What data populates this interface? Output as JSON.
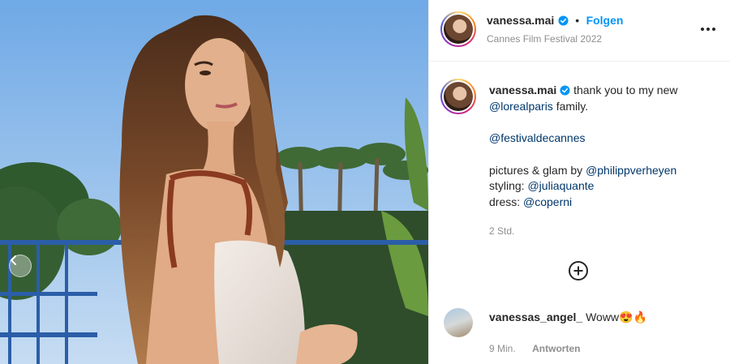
{
  "post": {
    "username": "vanessa.mai",
    "follow_label": "Folgen",
    "separator": "•",
    "location": "Cannes Film Festival 2022",
    "more_icon": "more-horizontal-icon"
  },
  "caption": {
    "username": "vanessa.mai",
    "text": "thank you to my new",
    "mention_1": "@lorealparis",
    "text_after_1": " family.",
    "mention_2": "@festivaldecannes",
    "credit_pictures": "pictures & glam by ",
    "mention_3": "@philippverheyen",
    "credit_styling": "styling: ",
    "mention_4": "@juliaquante",
    "credit_dress": "dress: ",
    "mention_5": "@coperni",
    "time": "2 Std."
  },
  "load_more_icon": "plus-circle-icon",
  "comments": [
    {
      "username": "vanessas_angel_",
      "text": "Woww😍🔥",
      "time": "9 Min.",
      "reply_label": "Antworten"
    }
  ],
  "colors": {
    "accent": "#0095f6",
    "mention": "#00376b",
    "muted": "#8e8e8e",
    "text": "#262626",
    "sky": "#7fb6ea"
  }
}
